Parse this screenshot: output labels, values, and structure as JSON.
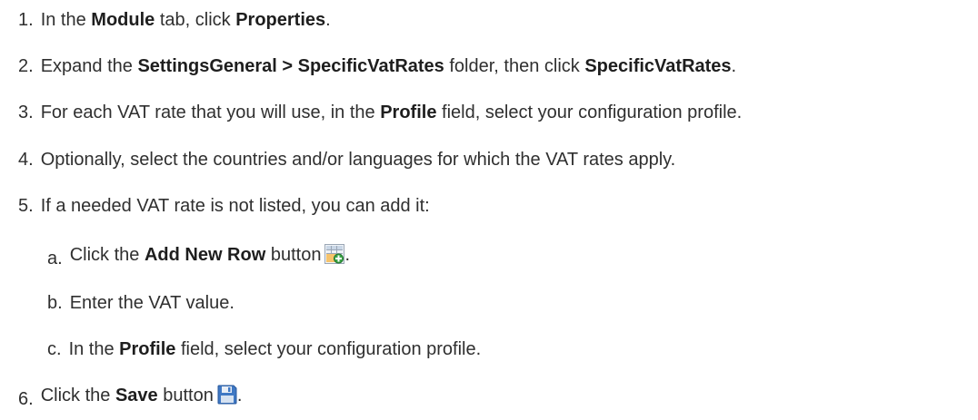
{
  "steps": [
    {
      "num": "1.",
      "parts": [
        "In the ",
        "Module",
        " tab, click ",
        "Properties",
        "."
      ]
    },
    {
      "num": "2.",
      "parts": [
        "Expand the ",
        "SettingsGeneral > SpecificVatRates",
        " folder, then click ",
        "SpecificVatRates",
        "."
      ]
    },
    {
      "num": "3.",
      "parts": [
        "For each VAT rate that you will use, in the ",
        "Profile",
        " field, select your configuration profile."
      ]
    },
    {
      "num": "4.",
      "text": "Optionally, select the countries and/or languages for which the VAT rates apply."
    },
    {
      "num": "5.",
      "text": "If a needed VAT rate is not listed, you can add it:"
    },
    {
      "num": "6.",
      "parts": [
        "Click the ",
        "Save",
        " button",
        "."
      ]
    }
  ],
  "substeps": [
    {
      "num": "a.",
      "parts": [
        "Click the ",
        "Add New Row",
        " button",
        "."
      ]
    },
    {
      "num": "b.",
      "text": "Enter the VAT value."
    },
    {
      "num": "c.",
      "parts": [
        "In the ",
        "Profile",
        " field, select your configuration profile."
      ]
    }
  ],
  "icons": {
    "add_row": "add-new-row-icon",
    "save": "save-icon"
  }
}
